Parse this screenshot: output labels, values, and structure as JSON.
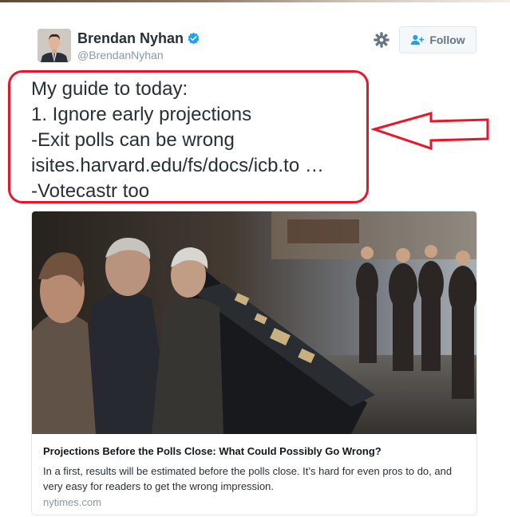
{
  "user": {
    "name": "Brendan Nyhan",
    "handle": "@BrendanNyhan",
    "verified": true
  },
  "actions": {
    "follow_label": "Follow"
  },
  "tweet": {
    "lines": [
      "My guide to today:",
      "1. Ignore early projections",
      "-Exit polls can be wrong",
      "isites.harvard.edu/fs/docs/icb.to …",
      "-Votecastr too"
    ]
  },
  "card": {
    "title": "Projections Before the Polls Close: What Could Possibly Go Wrong?",
    "description": "In a first, results will be estimated before the polls close. It’s hard for even pros to do, and very easy for readers to get the wrong impression.",
    "domain": "nytimes.com"
  },
  "colors": {
    "annotation_red": "#e8152b",
    "verified_blue": "#1da1f2",
    "handle_gray": "#8899a6"
  }
}
